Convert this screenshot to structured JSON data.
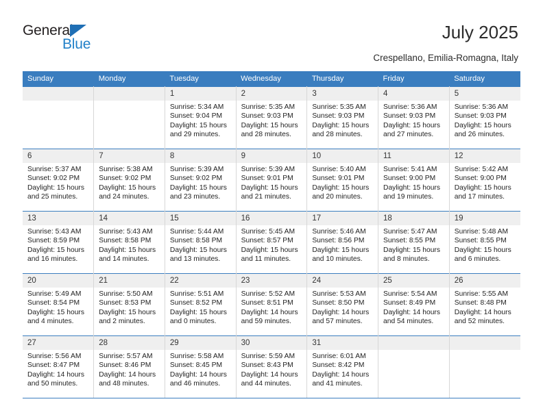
{
  "brand": {
    "name_top": "General",
    "name_bottom": "Blue",
    "accent_color": "#2180c8",
    "triangle_color": "#1f6fb5"
  },
  "header": {
    "title": "July 2025",
    "subtitle": "Crespellano, Emilia-Romagna, Italy"
  },
  "calendar": {
    "header_bg": "#3a7dbf",
    "header_text_color": "#ffffff",
    "daynum_bg": "#efefef",
    "weekdays": [
      "Sunday",
      "Monday",
      "Tuesday",
      "Wednesday",
      "Thursday",
      "Friday",
      "Saturday"
    ],
    "weeks": [
      [
        {
          "day": "",
          "blank": true
        },
        {
          "day": "",
          "blank": true
        },
        {
          "day": "1",
          "sunrise": "Sunrise: 5:34 AM",
          "sunset": "Sunset: 9:04 PM",
          "daylight_line1": "Daylight: 15 hours",
          "daylight_line2": "and 29 minutes."
        },
        {
          "day": "2",
          "sunrise": "Sunrise: 5:35 AM",
          "sunset": "Sunset: 9:03 PM",
          "daylight_line1": "Daylight: 15 hours",
          "daylight_line2": "and 28 minutes."
        },
        {
          "day": "3",
          "sunrise": "Sunrise: 5:35 AM",
          "sunset": "Sunset: 9:03 PM",
          "daylight_line1": "Daylight: 15 hours",
          "daylight_line2": "and 28 minutes."
        },
        {
          "day": "4",
          "sunrise": "Sunrise: 5:36 AM",
          "sunset": "Sunset: 9:03 PM",
          "daylight_line1": "Daylight: 15 hours",
          "daylight_line2": "and 27 minutes."
        },
        {
          "day": "5",
          "sunrise": "Sunrise: 5:36 AM",
          "sunset": "Sunset: 9:03 PM",
          "daylight_line1": "Daylight: 15 hours",
          "daylight_line2": "and 26 minutes."
        }
      ],
      [
        {
          "day": "6",
          "sunrise": "Sunrise: 5:37 AM",
          "sunset": "Sunset: 9:02 PM",
          "daylight_line1": "Daylight: 15 hours",
          "daylight_line2": "and 25 minutes."
        },
        {
          "day": "7",
          "sunrise": "Sunrise: 5:38 AM",
          "sunset": "Sunset: 9:02 PM",
          "daylight_line1": "Daylight: 15 hours",
          "daylight_line2": "and 24 minutes."
        },
        {
          "day": "8",
          "sunrise": "Sunrise: 5:39 AM",
          "sunset": "Sunset: 9:02 PM",
          "daylight_line1": "Daylight: 15 hours",
          "daylight_line2": "and 23 minutes."
        },
        {
          "day": "9",
          "sunrise": "Sunrise: 5:39 AM",
          "sunset": "Sunset: 9:01 PM",
          "daylight_line1": "Daylight: 15 hours",
          "daylight_line2": "and 21 minutes."
        },
        {
          "day": "10",
          "sunrise": "Sunrise: 5:40 AM",
          "sunset": "Sunset: 9:01 PM",
          "daylight_line1": "Daylight: 15 hours",
          "daylight_line2": "and 20 minutes."
        },
        {
          "day": "11",
          "sunrise": "Sunrise: 5:41 AM",
          "sunset": "Sunset: 9:00 PM",
          "daylight_line1": "Daylight: 15 hours",
          "daylight_line2": "and 19 minutes."
        },
        {
          "day": "12",
          "sunrise": "Sunrise: 5:42 AM",
          "sunset": "Sunset: 9:00 PM",
          "daylight_line1": "Daylight: 15 hours",
          "daylight_line2": "and 17 minutes."
        }
      ],
      [
        {
          "day": "13",
          "sunrise": "Sunrise: 5:43 AM",
          "sunset": "Sunset: 8:59 PM",
          "daylight_line1": "Daylight: 15 hours",
          "daylight_line2": "and 16 minutes."
        },
        {
          "day": "14",
          "sunrise": "Sunrise: 5:43 AM",
          "sunset": "Sunset: 8:58 PM",
          "daylight_line1": "Daylight: 15 hours",
          "daylight_line2": "and 14 minutes."
        },
        {
          "day": "15",
          "sunrise": "Sunrise: 5:44 AM",
          "sunset": "Sunset: 8:58 PM",
          "daylight_line1": "Daylight: 15 hours",
          "daylight_line2": "and 13 minutes."
        },
        {
          "day": "16",
          "sunrise": "Sunrise: 5:45 AM",
          "sunset": "Sunset: 8:57 PM",
          "daylight_line1": "Daylight: 15 hours",
          "daylight_line2": "and 11 minutes."
        },
        {
          "day": "17",
          "sunrise": "Sunrise: 5:46 AM",
          "sunset": "Sunset: 8:56 PM",
          "daylight_line1": "Daylight: 15 hours",
          "daylight_line2": "and 10 minutes."
        },
        {
          "day": "18",
          "sunrise": "Sunrise: 5:47 AM",
          "sunset": "Sunset: 8:55 PM",
          "daylight_line1": "Daylight: 15 hours",
          "daylight_line2": "and 8 minutes."
        },
        {
          "day": "19",
          "sunrise": "Sunrise: 5:48 AM",
          "sunset": "Sunset: 8:55 PM",
          "daylight_line1": "Daylight: 15 hours",
          "daylight_line2": "and 6 minutes."
        }
      ],
      [
        {
          "day": "20",
          "sunrise": "Sunrise: 5:49 AM",
          "sunset": "Sunset: 8:54 PM",
          "daylight_line1": "Daylight: 15 hours",
          "daylight_line2": "and 4 minutes."
        },
        {
          "day": "21",
          "sunrise": "Sunrise: 5:50 AM",
          "sunset": "Sunset: 8:53 PM",
          "daylight_line1": "Daylight: 15 hours",
          "daylight_line2": "and 2 minutes."
        },
        {
          "day": "22",
          "sunrise": "Sunrise: 5:51 AM",
          "sunset": "Sunset: 8:52 PM",
          "daylight_line1": "Daylight: 15 hours",
          "daylight_line2": "and 0 minutes."
        },
        {
          "day": "23",
          "sunrise": "Sunrise: 5:52 AM",
          "sunset": "Sunset: 8:51 PM",
          "daylight_line1": "Daylight: 14 hours",
          "daylight_line2": "and 59 minutes."
        },
        {
          "day": "24",
          "sunrise": "Sunrise: 5:53 AM",
          "sunset": "Sunset: 8:50 PM",
          "daylight_line1": "Daylight: 14 hours",
          "daylight_line2": "and 57 minutes."
        },
        {
          "day": "25",
          "sunrise": "Sunrise: 5:54 AM",
          "sunset": "Sunset: 8:49 PM",
          "daylight_line1": "Daylight: 14 hours",
          "daylight_line2": "and 54 minutes."
        },
        {
          "day": "26",
          "sunrise": "Sunrise: 5:55 AM",
          "sunset": "Sunset: 8:48 PM",
          "daylight_line1": "Daylight: 14 hours",
          "daylight_line2": "and 52 minutes."
        }
      ],
      [
        {
          "day": "27",
          "sunrise": "Sunrise: 5:56 AM",
          "sunset": "Sunset: 8:47 PM",
          "daylight_line1": "Daylight: 14 hours",
          "daylight_line2": "and 50 minutes."
        },
        {
          "day": "28",
          "sunrise": "Sunrise: 5:57 AM",
          "sunset": "Sunset: 8:46 PM",
          "daylight_line1": "Daylight: 14 hours",
          "daylight_line2": "and 48 minutes."
        },
        {
          "day": "29",
          "sunrise": "Sunrise: 5:58 AM",
          "sunset": "Sunset: 8:45 PM",
          "daylight_line1": "Daylight: 14 hours",
          "daylight_line2": "and 46 minutes."
        },
        {
          "day": "30",
          "sunrise": "Sunrise: 5:59 AM",
          "sunset": "Sunset: 8:43 PM",
          "daylight_line1": "Daylight: 14 hours",
          "daylight_line2": "and 44 minutes."
        },
        {
          "day": "31",
          "sunrise": "Sunrise: 6:01 AM",
          "sunset": "Sunset: 8:42 PM",
          "daylight_line1": "Daylight: 14 hours",
          "daylight_line2": "and 41 minutes."
        },
        {
          "day": "",
          "blank": true
        },
        {
          "day": "",
          "blank": true
        }
      ]
    ]
  }
}
